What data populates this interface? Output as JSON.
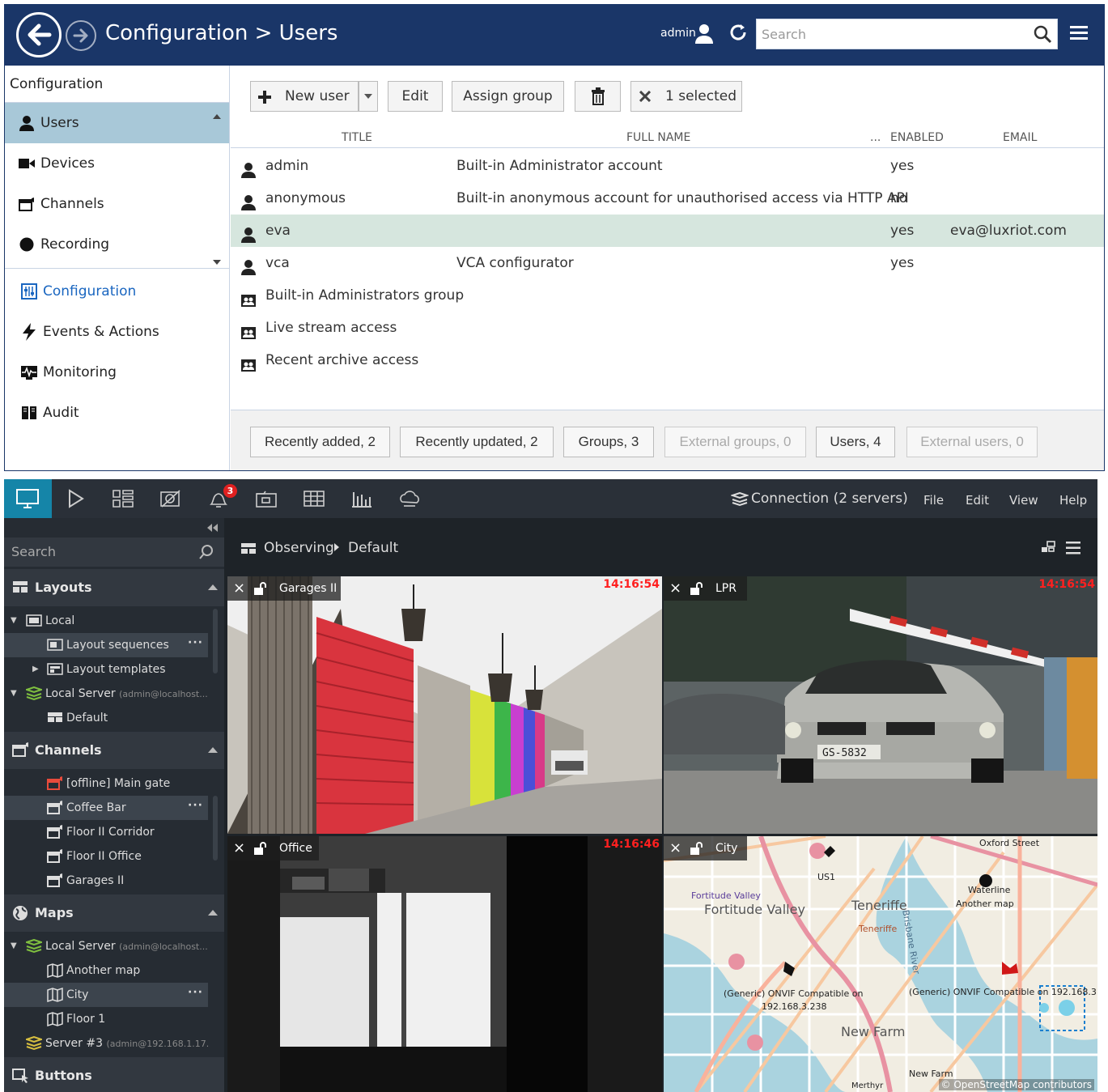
{
  "web": {
    "header": {
      "title": "Configuration > Users",
      "user": "admin",
      "search_placeholder": "Search"
    },
    "sidebar": {
      "heading": "Configuration",
      "items": [
        {
          "label": "Users",
          "icon": "user-icon",
          "active": true
        },
        {
          "label": "Devices",
          "icon": "camera-icon"
        },
        {
          "label": "Channels",
          "icon": "channel-icon"
        },
        {
          "label": "Recording",
          "icon": "record-icon"
        }
      ],
      "sections": [
        {
          "label": "Configuration",
          "icon": "configuration-icon",
          "active": true
        },
        {
          "label": "Events & Actions",
          "icon": "lightning-icon"
        },
        {
          "label": "Monitoring",
          "icon": "monitoring-icon"
        },
        {
          "label": "Audit",
          "icon": "audit-icon"
        }
      ]
    },
    "toolbar": {
      "new_user": "New user",
      "edit": "Edit",
      "assign_group": "Assign group",
      "selected": "1 selected"
    },
    "table": {
      "columns": {
        "title": "TITLE",
        "full_name": "FULL NAME",
        "more": "...",
        "enabled": "ENABLED",
        "email": "EMAIL"
      },
      "rows": [
        {
          "type": "user",
          "title": "admin",
          "full_name": "Built-in Administrator account",
          "enabled": "yes",
          "email": ""
        },
        {
          "type": "user",
          "title": "anonymous",
          "full_name": "Built-in anonymous account for unauthorised access via HTTP API",
          "enabled": "no",
          "email": ""
        },
        {
          "type": "user",
          "title": "eva",
          "full_name": "",
          "enabled": "yes",
          "email": "eva@luxriot.com",
          "selected": true
        },
        {
          "type": "user",
          "title": "vca",
          "full_name": "VCA configurator",
          "enabled": "yes",
          "email": ""
        },
        {
          "type": "group",
          "title": "Built-in Administrators group",
          "full_name": "",
          "enabled": "",
          "email": ""
        },
        {
          "type": "group",
          "title": "Live stream access",
          "full_name": "",
          "enabled": "",
          "email": ""
        },
        {
          "type": "group",
          "title": "Recent archive access",
          "full_name": "",
          "enabled": "",
          "email": ""
        }
      ]
    },
    "filters": [
      {
        "label": "Recently added, 2"
      },
      {
        "label": "Recently updated, 2"
      },
      {
        "label": "Groups, 3"
      },
      {
        "label": "External groups, 0",
        "disabled": true
      },
      {
        "label": "Users, 4"
      },
      {
        "label": "External users, 0",
        "disabled": true
      }
    ]
  },
  "desktop": {
    "notification_count": "3",
    "connection": "Connection (2 servers)",
    "menu": [
      "File",
      "Edit",
      "View",
      "Help"
    ],
    "search_label": "Search",
    "sections": {
      "layouts": "Layouts",
      "channels": "Channels",
      "maps": "Maps",
      "buttons": "Buttons"
    },
    "layouts_tree": {
      "local": "Local",
      "layout_sequences": "Layout sequences",
      "layout_templates": "Layout templates",
      "local_server": "Local Server",
      "local_server_sub": "(admin@localhost...",
      "default": "Default"
    },
    "channels_tree": [
      "[offline] Main gate",
      "Coffee Bar",
      "Floor II Corridor",
      "Floor II Office",
      "Garages II"
    ],
    "maps_tree": {
      "local_server": "Local Server",
      "local_server_sub": "(admin@localhost...",
      "items": [
        "Another map",
        "City",
        "Floor 1"
      ],
      "server3": "Server #3",
      "server3_sub": "(admin@192.168.1.17..."
    },
    "breadcrumb": {
      "first": "Observing",
      "second": "Default"
    },
    "cells": [
      {
        "name": "Garages II",
        "time": "14:16:54"
      },
      {
        "name": "LPR",
        "time": "14:16:54"
      },
      {
        "name": "Office",
        "time": "14:16:46"
      },
      {
        "name": "City"
      }
    ],
    "plate": "GS-5832",
    "map_labels": {
      "fortitude1": "Fortitude Valley",
      "fortitude2": "Fortitude Valley",
      "teneriffe1": "Teneriffe",
      "teneriffe2": "Teneriffe",
      "newfarm": "New Farm",
      "newfarm2": "New Farm",
      "oxford": "Oxford Street",
      "waterline": "Waterline",
      "anothermap": "Another map",
      "onvif1": "(Generic) ONVIF Compatible on",
      "onvif1b": "192.168.3.238",
      "onvif2": "(Generic) ONVIF Compatible on 192.168.3",
      "us1": "US1",
      "brisbane": "Brisbane River",
      "merthyr": "Merthyr",
      "attribution": "© OpenStreetMap contributors"
    }
  }
}
